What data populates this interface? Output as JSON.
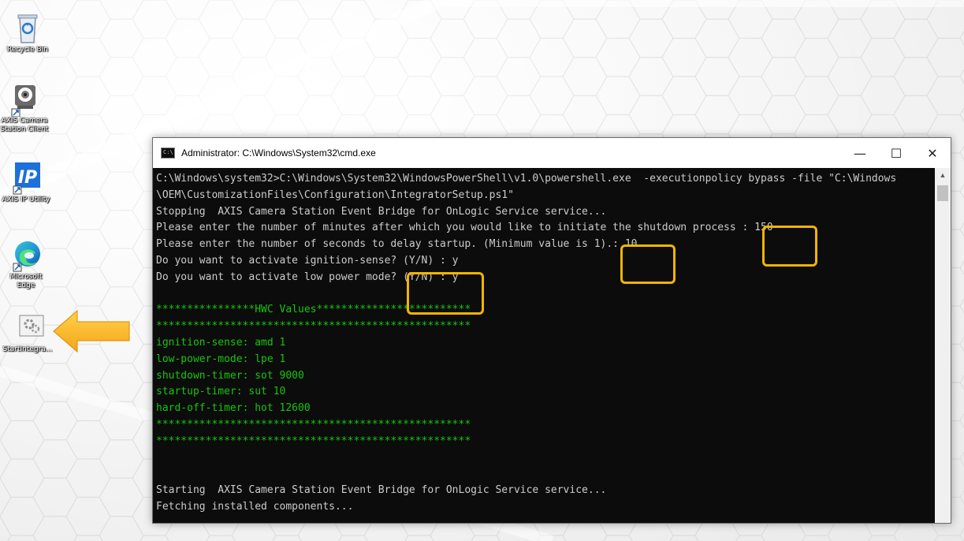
{
  "desktop": {
    "icons": [
      {
        "label": "Recycle Bin",
        "icon": "recycle-bin-icon"
      },
      {
        "label": "AXIS Camera Station Client",
        "icon": "axis-camera-icon"
      },
      {
        "label": "AXIS IP Utility",
        "icon": "ip-utility-icon"
      },
      {
        "label": "Microsoft Edge",
        "icon": "edge-icon"
      },
      {
        "label": "StartIntegra...",
        "icon": "gear-script-icon"
      }
    ],
    "icon_labels_display": {
      "recycle": "Recycle Bin",
      "axis_line1": "AXIS Camera",
      "axis_line2": "Station Client",
      "ip": "AXIS IP Utility",
      "edge_line1": "Microsoft",
      "edge_line2": "Edge",
      "start": "StartIntegra..."
    },
    "callout_color": "#f5b400"
  },
  "window": {
    "title": "Administrator: C:\\Windows\\System32\\cmd.exe",
    "minimize": "—",
    "maximize": "☐",
    "close": "✕",
    "scroll_up": "▲"
  },
  "console": {
    "lines": [
      {
        "text": "C:\\Windows\\system32>C:\\Windows\\System32\\WindowsPowerShell\\v1.0\\powershell.exe  -executionpolicy bypass -file \"C:\\Windows",
        "color": "white"
      },
      {
        "text": "\\OEM\\CustomizationFiles\\Configuration\\IntegratorSetup.ps1\"",
        "color": "white"
      },
      {
        "text": "Stopping  AXIS Camera Station Event Bridge for OnLogic Service service...",
        "color": "white"
      },
      {
        "text": "Please enter the number of minutes after which you would like to initiate the shutdown process : 150",
        "color": "white"
      },
      {
        "text": "Please enter the number of seconds to delay startup. (Minimum value is 1).: 10",
        "color": "white"
      },
      {
        "text": "Do you want to activate ignition-sense? (Y/N) : y",
        "color": "white"
      },
      {
        "text": "Do you want to activate low power mode? (Y/N) : y",
        "color": "white"
      },
      {
        "text": "",
        "color": "white"
      },
      {
        "text": "****************HWC Values*************************",
        "color": "green"
      },
      {
        "text": "***************************************************",
        "color": "green"
      },
      {
        "text": "ignition-sense: amd 1",
        "color": "green"
      },
      {
        "text": "low-power-mode: lpe 1",
        "color": "green"
      },
      {
        "text": "shutdown-timer: sot 9000",
        "color": "green"
      },
      {
        "text": "startup-timer: sut 10",
        "color": "green"
      },
      {
        "text": "hard-off-timer: hot 12600",
        "color": "green"
      },
      {
        "text": "***************************************************",
        "color": "green"
      },
      {
        "text": "***************************************************",
        "color": "green"
      },
      {
        "text": "",
        "color": "white"
      },
      {
        "text": "",
        "color": "white"
      },
      {
        "text": "Starting  AXIS Camera Station Event Bridge for OnLogic Service service...",
        "color": "white"
      },
      {
        "text": "Fetching installed components...",
        "color": "white"
      }
    ],
    "green": "#16c60c",
    "white": "#cccccc"
  }
}
